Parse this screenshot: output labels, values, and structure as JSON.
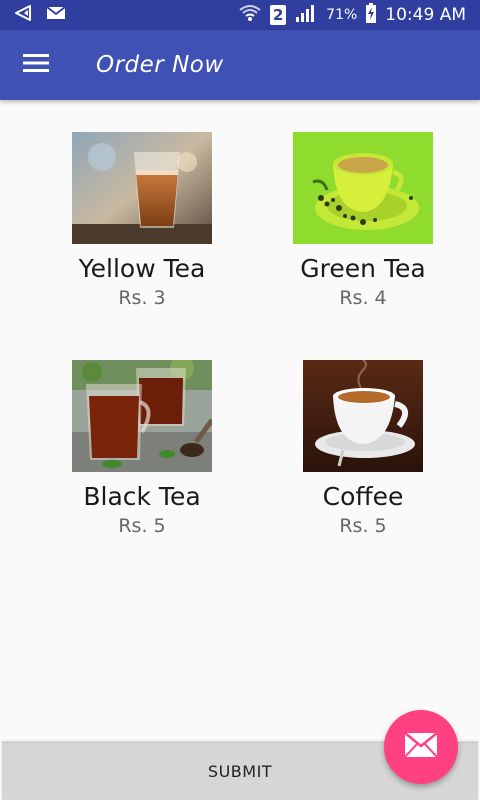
{
  "status_bar": {
    "sim_slot": "2",
    "battery": "71%",
    "time": "10:49 AM"
  },
  "app_bar": {
    "title": "Order Now",
    "menu_icon": "hamburger-menu-icon"
  },
  "items": [
    {
      "name": "Yellow Tea",
      "price": "Rs. 3"
    },
    {
      "name": "Green Tea",
      "price": "Rs. 4"
    },
    {
      "name": "Black Tea",
      "price": "Rs. 5"
    },
    {
      "name": "Coffee",
      "price": "Rs. 5"
    }
  ],
  "submit_label": "SUBMIT",
  "fab_icon": "mail-icon",
  "colors": {
    "status_bar": "#303f9f",
    "app_bar": "#3f51b5",
    "fab": "#ff4081",
    "background": "#fafafa"
  }
}
